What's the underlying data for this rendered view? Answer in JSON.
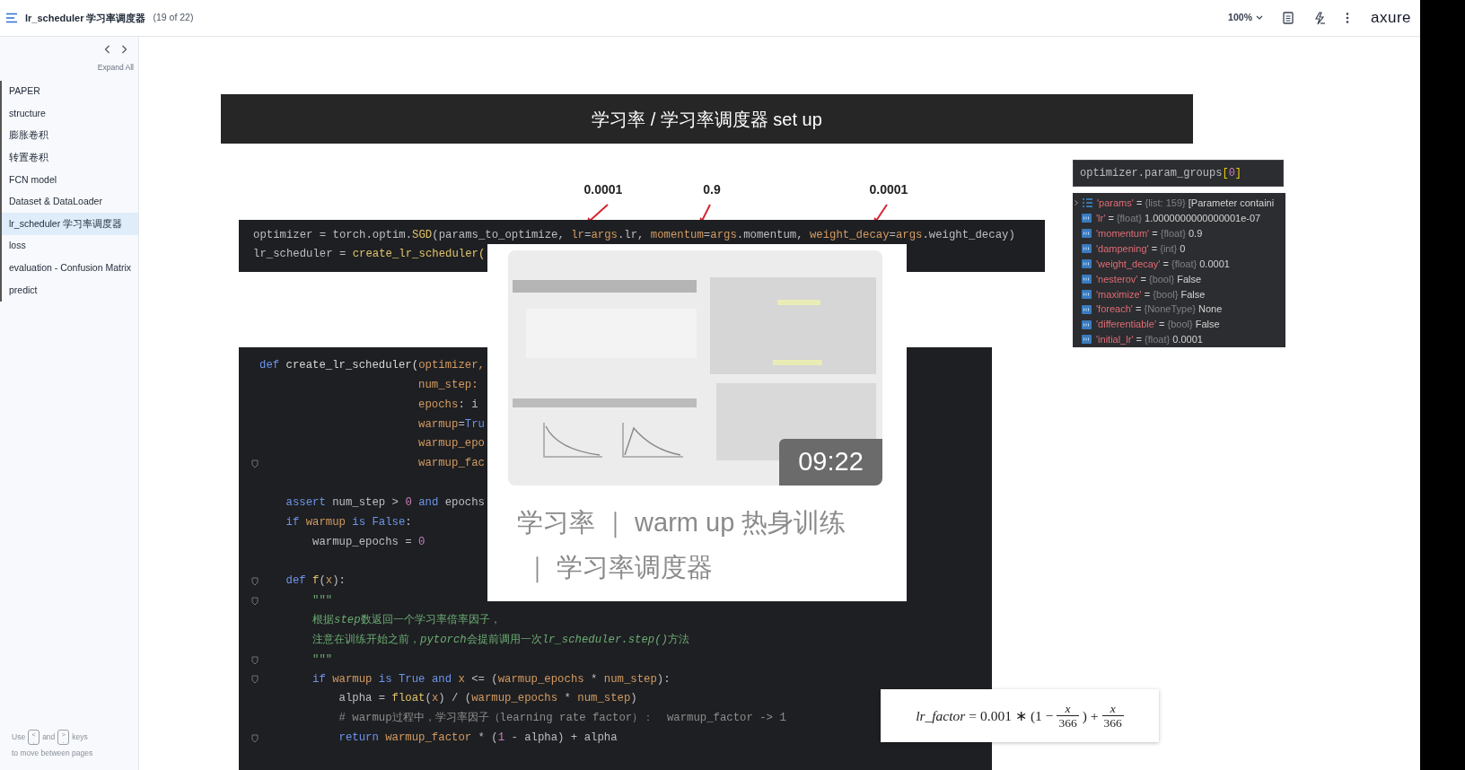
{
  "topbar": {
    "title": "lr_scheduler 学习率调度器",
    "page_count": "(19 of 22)",
    "zoom": "100%",
    "logo": "axure"
  },
  "sidebar": {
    "expand_all": "Expand All",
    "items": [
      {
        "label": "PAPER",
        "selected": false
      },
      {
        "label": "structure",
        "selected": false
      },
      {
        "label": "膨胀卷积",
        "selected": false
      },
      {
        "label": "转置卷积",
        "selected": false
      },
      {
        "label": "FCN model",
        "selected": false
      },
      {
        "label": "Dataset & DataLoader",
        "selected": false
      },
      {
        "label": "lr_scheduler 学习率调度器",
        "selected": true
      },
      {
        "label": "loss",
        "selected": false
      },
      {
        "label": "evaluation - Confusion Matrix",
        "selected": false
      },
      {
        "label": "predict",
        "selected": false
      }
    ],
    "hint": {
      "before": "Use",
      "key1": {
        "top": "<",
        "bottom": ","
      },
      "middle": "and",
      "key2": {
        "top": ">",
        "bottom": "."
      },
      "after": "keys",
      "line2": "to move between pages"
    }
  },
  "banner": {
    "title": "学习率 / 学习率调度器 set up"
  },
  "annotations": [
    {
      "label": "0.0001"
    },
    {
      "label": "0.9"
    },
    {
      "label": "0.0001"
    }
  ],
  "code_top": {
    "lines": [
      {
        "segments": [
          {
            "kind": "plain",
            "text": "optimizer = torch.optim."
          },
          {
            "kind": "call",
            "text": "SGD"
          },
          {
            "kind": "plain",
            "text": "(params_to_optimize, "
          },
          {
            "kind": "arg",
            "text": "lr"
          },
          {
            "kind": "plain",
            "text": "="
          },
          {
            "kind": "arg",
            "text": "args"
          },
          {
            "kind": "plain",
            "text": ".lr, "
          },
          {
            "kind": "arg",
            "text": "momentum"
          },
          {
            "kind": "plain",
            "text": "="
          },
          {
            "kind": "arg",
            "text": "args"
          },
          {
            "kind": "plain",
            "text": ".momentum, "
          },
          {
            "kind": "arg",
            "text": "weight_decay"
          },
          {
            "kind": "plain",
            "text": "="
          },
          {
            "kind": "arg",
            "text": "args"
          },
          {
            "kind": "plain",
            "text": ".weight_decay)"
          }
        ]
      },
      {
        "segments": [
          {
            "kind": "plain",
            "text": "lr_scheduler = "
          },
          {
            "kind": "call",
            "text": "create_lr_scheduler("
          }
        ]
      }
    ]
  },
  "video_card": {
    "duration": "09:22",
    "caption_lines": [
      "学习率 ｜ warm up 热身训练",
      "｜ 学习率调度器"
    ]
  },
  "code_main": {
    "lines": [
      {
        "fold": false,
        "segments": [
          {
            "kind": "keyword",
            "text": "def "
          },
          {
            "kind": "name",
            "text": "create_lr_scheduler("
          },
          {
            "kind": "arg",
            "text": "optimizer,"
          }
        ]
      },
      {
        "fold": false,
        "segments": [
          {
            "kind": "arg",
            "text": "                        num_step:"
          }
        ]
      },
      {
        "fold": false,
        "segments": [
          {
            "kind": "arg",
            "text": "                        epochs"
          },
          {
            "kind": "plain",
            "text": ": i"
          }
        ]
      },
      {
        "fold": false,
        "segments": [
          {
            "kind": "arg",
            "text": "                        warmup"
          },
          {
            "kind": "plain",
            "text": "="
          },
          {
            "kind": "keyword",
            "text": "Tru"
          }
        ]
      },
      {
        "fold": false,
        "segments": [
          {
            "kind": "arg",
            "text": "                        warmup_epo"
          }
        ]
      },
      {
        "fold": true,
        "segments": [
          {
            "kind": "arg",
            "text": "                        warmup_fac"
          }
        ]
      },
      {
        "fold": false
      },
      {
        "fold": false,
        "segments": [
          {
            "kind": "keyword",
            "text": "    assert "
          },
          {
            "kind": "plain",
            "text": "num_step > "
          },
          {
            "kind": "num",
            "text": "0"
          },
          {
            "kind": "keyword",
            "text": " and "
          },
          {
            "kind": "plain",
            "text": "epochs"
          }
        ]
      },
      {
        "fold": false,
        "segments": [
          {
            "kind": "keyword",
            "text": "    if "
          },
          {
            "kind": "arg",
            "text": "warmup"
          },
          {
            "kind": "keyword",
            "text": " is False"
          },
          {
            "kind": "plain",
            "text": ":"
          }
        ]
      },
      {
        "fold": false,
        "segments": [
          {
            "kind": "plain",
            "text": "        warmup_epochs = "
          },
          {
            "kind": "num",
            "text": "0"
          }
        ]
      },
      {
        "fold": false
      },
      {
        "fold": true,
        "segments": [
          {
            "kind": "keyword",
            "text": "    def "
          },
          {
            "kind": "call",
            "text": "f"
          },
          {
            "kind": "plain",
            "text": "("
          },
          {
            "kind": "arg",
            "text": "x"
          },
          {
            "kind": "plain",
            "text": "):"
          }
        ]
      },
      {
        "fold": true,
        "segments": [
          {
            "kind": "doc",
            "text": "        \"\"\""
          }
        ]
      },
      {
        "fold": false,
        "segments": [
          {
            "kind": "doc",
            "text": "        根据"
          },
          {
            "kind": "docitalic",
            "text": "step"
          },
          {
            "kind": "doc",
            "text": "数返回一个学习率倍率因子，"
          }
        ]
      },
      {
        "fold": false,
        "segments": [
          {
            "kind": "doc",
            "text": "        注意在训练开始之前，"
          },
          {
            "kind": "docitalic",
            "text": "pytorch"
          },
          {
            "kind": "doc",
            "text": "会提前调用一次"
          },
          {
            "kind": "docitalic",
            "text": "lr_scheduler.step()"
          },
          {
            "kind": "doc",
            "text": "方法"
          }
        ]
      },
      {
        "fold": true,
        "segments": [
          {
            "kind": "doc",
            "text": "        \"\"\""
          }
        ]
      },
      {
        "fold": true,
        "segments": [
          {
            "kind": "keyword",
            "text": "        if "
          },
          {
            "kind": "arg",
            "text": "warmup"
          },
          {
            "kind": "keyword",
            "text": " is True and "
          },
          {
            "kind": "arg",
            "text": "x"
          },
          {
            "kind": "plain",
            "text": " <= ("
          },
          {
            "kind": "arg",
            "text": "warmup_epochs"
          },
          {
            "kind": "plain",
            "text": " * "
          },
          {
            "kind": "arg",
            "text": "num_step"
          },
          {
            "kind": "plain",
            "text": "):"
          }
        ]
      },
      {
        "fold": false,
        "segments": [
          {
            "kind": "plain",
            "text": "            alpha = "
          },
          {
            "kind": "call",
            "text": "float"
          },
          {
            "kind": "plain",
            "text": "("
          },
          {
            "kind": "arg",
            "text": "x"
          },
          {
            "kind": "plain",
            "text": ") / ("
          },
          {
            "kind": "arg",
            "text": "warmup_epochs"
          },
          {
            "kind": "plain",
            "text": " * "
          },
          {
            "kind": "arg",
            "text": "num_step"
          },
          {
            "kind": "plain",
            "text": ")"
          }
        ]
      },
      {
        "fold": false,
        "segments": [
          {
            "kind": "comment",
            "text": "            # warmup过程中，学习率因子（learning rate factor）：  warmup_factor -> 1"
          }
        ]
      },
      {
        "fold": true,
        "segments": [
          {
            "kind": "keyword",
            "text": "            return "
          },
          {
            "kind": "arg",
            "text": "warmup_factor"
          },
          {
            "kind": "plain",
            "text": " * ("
          },
          {
            "kind": "num",
            "text": "1"
          },
          {
            "kind": "plain",
            "text": " - alpha) + alpha"
          }
        ]
      }
    ]
  },
  "watch": {
    "expression": [
      {
        "kind": "plain",
        "text": "optimizer.param_groups"
      },
      {
        "kind": "bracket",
        "text": "["
      },
      {
        "kind": "num",
        "text": "0"
      },
      {
        "kind": "bracket",
        "text": "]"
      }
    ],
    "variables": [
      {
        "kind": "list",
        "name": "'params'",
        "operator": "=",
        "type": "{list: 159}",
        "value": "[Parameter containi"
      },
      {
        "kind": "field",
        "name": "'lr'",
        "operator": "=",
        "type": "{float}",
        "value": "1.0000000000000001e-07"
      },
      {
        "kind": "field",
        "name": "'momentum'",
        "operator": "=",
        "type": "{float}",
        "value": "0.9"
      },
      {
        "kind": "field",
        "name": "'dampening'",
        "operator": "=",
        "type": "{int}",
        "value": "0"
      },
      {
        "kind": "field",
        "name": "'weight_decay'",
        "operator": "=",
        "type": "{float}",
        "value": "0.0001"
      },
      {
        "kind": "field",
        "name": "'nesterov'",
        "operator": "=",
        "type": "{bool}",
        "value": "False"
      },
      {
        "kind": "field",
        "name": "'maximize'",
        "operator": "=",
        "type": "{bool}",
        "value": "False"
      },
      {
        "kind": "field",
        "name": "'foreach'",
        "operator": "=",
        "type": "{NoneType}",
        "value": "None"
      },
      {
        "kind": "field",
        "name": "'differentiable'",
        "operator": "=",
        "type": "{bool}",
        "value": "False"
      },
      {
        "kind": "field",
        "name": "'initial_lr'",
        "operator": "=",
        "type": "{float}",
        "value": "0.0001"
      }
    ]
  },
  "formula": {
    "lhs": "lr_factor",
    "eq": "=",
    "coef": "0.001",
    "op": "∗",
    "open": "(1 −",
    "frac1": {
      "num": "x",
      "den": "366"
    },
    "close": ")",
    "plus": "+",
    "frac2": {
      "num": "x",
      "den": "366"
    }
  }
}
